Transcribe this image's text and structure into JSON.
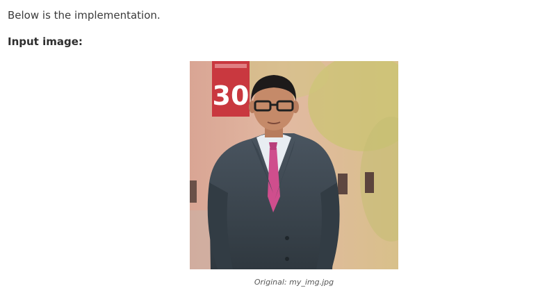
{
  "intro_text": "Below is the implementation.",
  "input_heading": "Input image:",
  "photo": {
    "sign_number": "30",
    "caption": "Original: my_img.jpg",
    "icon": "photo-portrait"
  },
  "colors": {
    "background": "#ffffff",
    "text": "#3a3a3a",
    "caption": "#555555",
    "sign_red": "#c9383f"
  }
}
